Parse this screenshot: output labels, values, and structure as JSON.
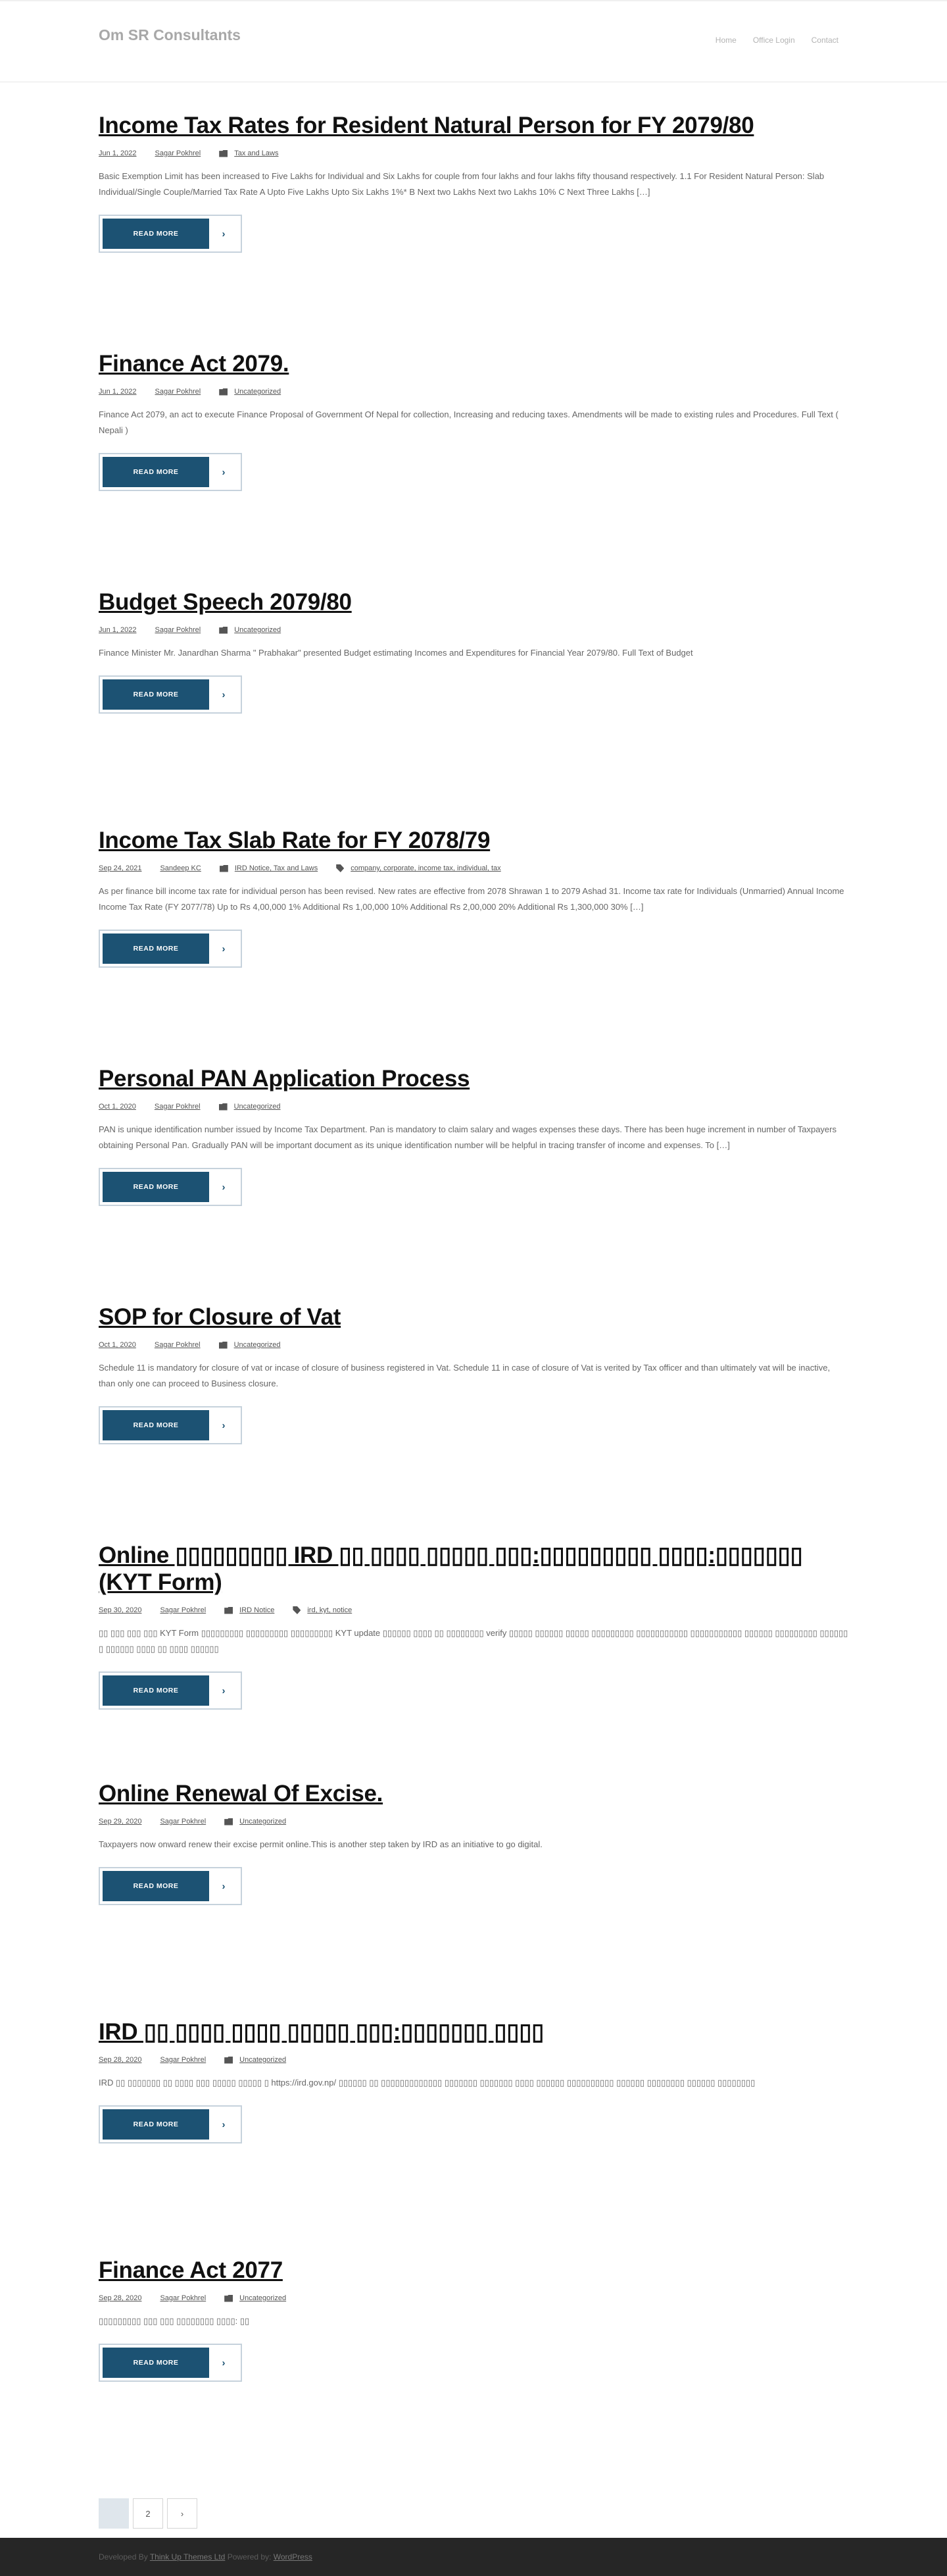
{
  "header": {
    "site_title": "Om SR Consultants",
    "nav": [
      "Home",
      "Office Login",
      "Contact"
    ]
  },
  "posts": [
    {
      "title": "Income Tax Rates for Resident Natural Person for FY 2079/80",
      "date": "Jun 1, 2022",
      "author": "Sagar Pokhrel",
      "categories": "Tax and Laws",
      "tags": "",
      "excerpt": "Basic Exemption Limit has been increased to Five Lakhs for Individual and Six Lakhs for couple from four lakhs and four lakhs fifty thousand respectively. 1.1 For Resident Natural Person: Slab Individual/Single  Couple/Married  Tax Rate  A Upto Five Lakhs Upto Six Lakhs  1%* B Next two Lakhs  Next two Lakhs  10% C Next Three Lakhs […]",
      "read_more": "READ MORE"
    },
    {
      "title": "Finance Act 2079.",
      "date": "Jun 1, 2022",
      "author": "Sagar Pokhrel",
      "categories": "Uncategorized",
      "tags": "",
      "excerpt": "Finance Act 2079, an act to execute Finance Proposal of Government Of Nepal for collection, Increasing and reducing taxes. Amendments will be made to existing rules and Procedures. Full Text ( Nepali )",
      "read_more": "READ MORE"
    },
    {
      "title": "Budget Speech 2079/80",
      "date": "Jun 1, 2022",
      "author": "Sagar Pokhrel",
      "categories": "Uncategorized",
      "tags": "",
      "excerpt": "Finance Minister Mr. Janardhan Sharma \" Prabhakar\" presented Budget estimating Incomes and Expenditures for Financial Year 2079/80. Full Text of Budget",
      "read_more": "READ MORE"
    },
    {
      "title": "Income Tax Slab Rate for FY 2078/79",
      "date": "Sep 24, 2021",
      "author": "Sandeep KC",
      "categories": "IRD Notice, Tax and Laws",
      "tags": "company, corporate, income tax, individual, tax",
      "excerpt": "As per finance bill income tax rate for individual person has been revised. New rates are effective from 2078 Shrawan 1 to 2079 Ashad 31. Income tax rate for Individuals (Unmarried) Annual Income Income Tax Rate (FY 2077/78) Up to Rs 4,00,000 1% Additional Rs 1,00,000 10% Additional Rs 2,00,000 20% Additional Rs 1,300,000 30% […]",
      "read_more": "READ MORE"
    },
    {
      "title": "Personal PAN Application Process",
      "date": "Oct 1, 2020",
      "author": "Sagar Pokhrel",
      "categories": "Uncategorized",
      "tags": "",
      "excerpt": "PAN is unique identification number issued by Income Tax Department. Pan is mandatory to claim salary and wages expenses these days. There has been huge increment in number of Taxpayers obtaining Personal Pan. Gradually PAN will be important document as its unique identification number will be helpful in tracing transfer of income and expenses. To […]",
      "read_more": "READ MORE"
    },
    {
      "title": "SOP for Closure of Vat",
      "date": "Oct 1, 2020",
      "author": "Sagar Pokhrel",
      "categories": "Uncategorized",
      "tags": "",
      "excerpt": "Schedule 11 is mandatory for closure of vat or incase of closure of business registered in Vat. Schedule 11 in case of closure of Vat is verited by Tax officer and than ultimately vat will be inactive, than only one can proceed to Business closure.",
      "read_more": "READ MORE"
    },
    {
      "title": "Online ▯▯▯▯▯▯▯▯▯ IRD ▯▯ ▯▯▯▯ ▯▯▯▯▯ ▯▯▯:▯▯▯▯▯▯▯▯▯ ▯▯▯▯:▯▯▯▯▯▯▯ (KYT Form)",
      "date": "Sep 30, 2020",
      "author": "Sagar Pokhrel",
      "categories": "IRD Notice",
      "tags": "ird, kyt, notice",
      "excerpt": "▯▯ ▯▯▯ ▯▯▯ ▯▯▯ KYT Form ▯▯▯▯▯▯▯▯▯ ▯▯▯▯▯▯▯▯▯ ▯▯▯▯▯▯▯▯▯ KYT update ▯▯▯▯▯▯ ▯▯▯▯ ▯▯ ▯▯▯▯▯▯▯▯ verify ▯▯▯▯▯ ▯▯▯▯▯▯ ▯▯▯▯▯ ▯▯▯▯▯▯▯▯▯ ▯▯▯▯▯▯▯▯▯▯▯ ▯▯▯▯▯▯▯▯▯▯▯ ▯▯▯▯▯▯ ▯▯▯▯▯▯▯▯▯ ▯▯▯▯▯▯ ▯ ▯▯▯▯▯▯ ▯▯▯▯ ▯▯ ▯▯▯▯ ▯▯▯▯▯▯",
      "read_more": "READ MORE"
    },
    {
      "title": "Online Renewal Of Excise.",
      "date": "Sep 29, 2020",
      "author": "Sagar Pokhrel",
      "categories": "Uncategorized",
      "tags": "",
      "excerpt": "Taxpayers now onward renew their excise permit online.This is another step taken by IRD as an initiative to go digital.",
      "read_more": "READ MORE"
    },
    {
      "title": "IRD ▯▯ ▯▯▯▯ ▯▯▯▯ ▯▯▯▯▯ ▯▯▯:▯▯▯▯▯▯▯ ▯▯▯▯",
      "date": "Sep 28, 2020",
      "author": "Sagar Pokhrel",
      "categories": "Uncategorized",
      "tags": "",
      "excerpt": "IRD ▯▯ ▯▯▯▯▯▯▯ ▯▯ ▯▯▯▯ ▯▯▯ ▯▯▯▯▯ ▯▯▯▯▯ ▯ https://ird.gov.np/ ▯▯▯▯▯▯ ▯▯ ▯▯▯▯▯▯▯▯▯▯▯▯▯ ▯▯▯▯▯▯▯ ▯▯▯▯▯▯▯ ▯▯▯▯ ▯▯▯▯▯▯ ▯▯▯▯▯▯▯▯▯▯ ▯▯▯▯▯▯ ▯▯▯▯▯▯▯▯ ▯▯▯▯▯▯ ▯▯▯▯▯▯▯▯",
      "read_more": "READ MORE"
    },
    {
      "title": "Finance Act 2077",
      "date": "Sep 28, 2020",
      "author": "Sagar Pokhrel",
      "categories": "Uncategorized",
      "tags": "",
      "excerpt": "▯▯▯▯▯▯▯▯▯ ▯▯▯ ▯▯▯ ▯▯▯▯▯▯▯▯ ▯▯▯▯: ▯▯",
      "read_more": "READ MORE"
    }
  ],
  "pagination": {
    "current": "1",
    "next_page": "2",
    "next_arrow": "›"
  },
  "footer": {
    "developed_by": "Developed By",
    "theme_link": "Think Up Themes Ltd",
    "powered_by": "Powered by:",
    "wp_link": "WordPress"
  },
  "colors": {
    "accent": "#1c5273",
    "footer_bg": "#262626",
    "pagination_current": "#dfe6ec"
  }
}
